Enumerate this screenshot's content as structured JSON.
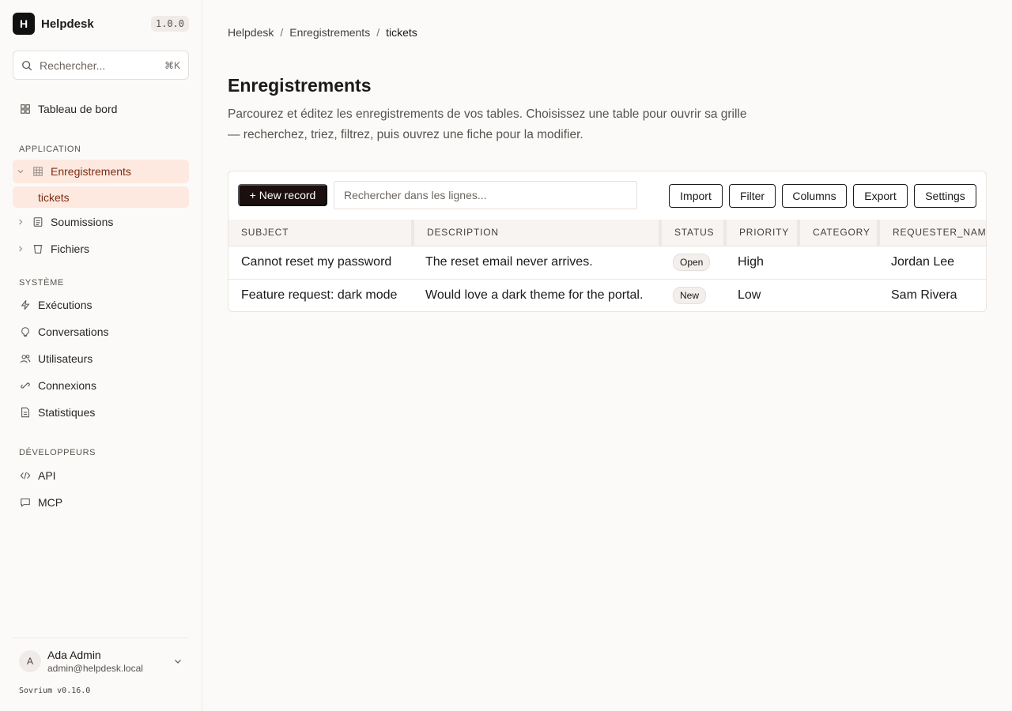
{
  "app": {
    "logo_letter": "H",
    "name": "Helpdesk",
    "version": "1.0.0"
  },
  "search": {
    "placeholder": "Rechercher...",
    "shortcut": "⌘K"
  },
  "nav": {
    "dashboard": "Tableau de bord",
    "section_application": "APPLICATION",
    "records": "Enregistrements",
    "records_sub": "tickets",
    "submissions": "Soumissions",
    "files": "Fichiers",
    "section_system": "SYSTÈME",
    "executions": "Exécutions",
    "conversations": "Conversations",
    "users": "Utilisateurs",
    "connections": "Connexions",
    "stats": "Statistiques",
    "section_developers": "DÉVELOPPEURS",
    "api": "API",
    "mcp": "MCP"
  },
  "user": {
    "initial": "A",
    "name": "Ada Admin",
    "email": "admin@helpdesk.local"
  },
  "footer": {
    "product_version": "Sovrium v0.16.0"
  },
  "breadcrumb": {
    "root": "Helpdesk",
    "section": "Enregistrements",
    "current": "tickets"
  },
  "page": {
    "title": "Enregistrements",
    "description": "Parcourez et éditez les enregistrements de vos tables. Choisissez une table pour ouvrir sa grille — recherchez, triez, filtrez, puis ouvrez une fiche pour la modifier."
  },
  "toolbar": {
    "new_record": "+ New record",
    "search_placeholder": "Rechercher dans les lignes...",
    "import": "Import",
    "filter": "Filter",
    "columns": "Columns",
    "export": "Export",
    "settings": "Settings"
  },
  "table": {
    "columns": [
      "SUBJECT",
      "DESCRIPTION",
      "STATUS",
      "PRIORITY",
      "CATEGORY",
      "REQUESTER_NAME"
    ],
    "rows": [
      {
        "subject": "Cannot reset my password",
        "description": "The reset email never arrives.",
        "status": "Open",
        "priority": "High",
        "category": "",
        "requester": "Jordan Lee"
      },
      {
        "subject": "Feature request: dark mode",
        "description": "Would love a dark theme for the portal.",
        "status": "New",
        "priority": "Low",
        "category": "",
        "requester": "Sam Rivera"
      }
    ]
  }
}
